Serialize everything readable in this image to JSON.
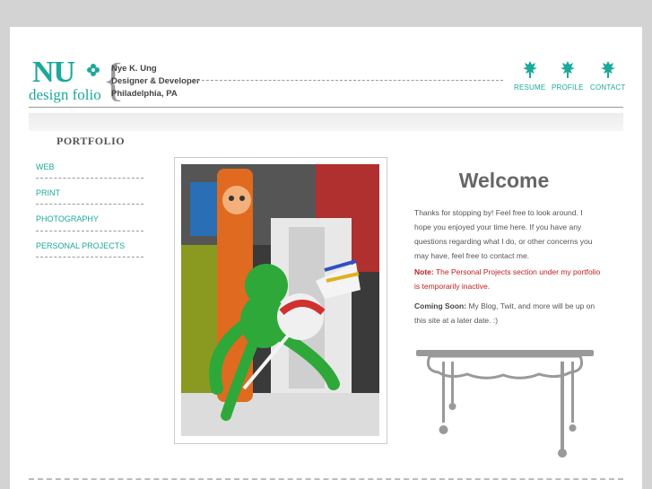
{
  "logo": {
    "main": "NU",
    "sub": "design folio"
  },
  "header": {
    "name": "Nye K. Ung",
    "role": "Designer & Developer",
    "location": "Philadelphia, PA"
  },
  "nav": [
    {
      "label": "RESUME",
      "icon": "flower-icon"
    },
    {
      "label": "PROFILE",
      "icon": "flower-icon"
    },
    {
      "label": "CONTACT",
      "icon": "flower-icon"
    }
  ],
  "sidebar": {
    "title": "PORTFOLIO",
    "items": [
      {
        "label": "WEB"
      },
      {
        "label": "PRINT"
      },
      {
        "label": "PHOTOGRAPHY"
      },
      {
        "label": "PERSONAL PROJECTS"
      }
    ]
  },
  "main": {
    "heading": "Welcome",
    "intro": "Thanks for stopping by! Feel free to look around. I hope you enjoyed your time here. If you have any questions regarding what I do, or other concerns you may have, feel free to contact me.",
    "note_label": "Note:",
    "note_text": "The Personal Projects section under my portfolio is temporarily inactive.",
    "coming_label": "Coming Soon:",
    "coming_text": "My Blog, Twit, and more will be up on this site at a later date. :)"
  },
  "colors": {
    "accent": "#1aa99a",
    "note_red": "#c02020",
    "page_bg": "#d3d3d3"
  }
}
